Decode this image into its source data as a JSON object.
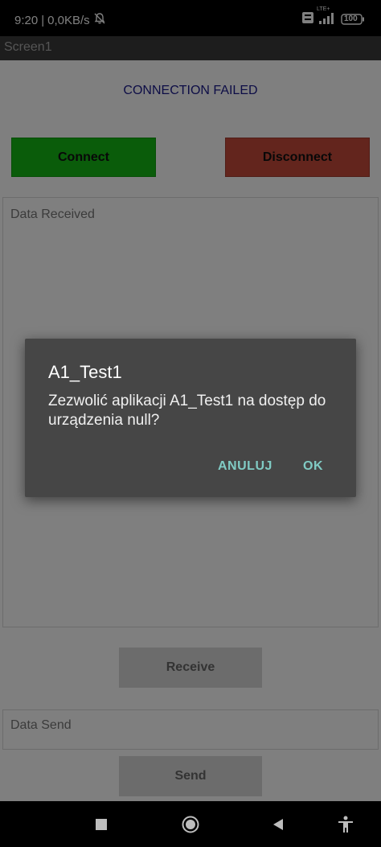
{
  "status_bar": {
    "time": "9:20",
    "separator": "|",
    "speed": "0,0KB/s",
    "network_badge": "LTE+",
    "battery": "100"
  },
  "app_bar": {
    "title": "Screen1"
  },
  "main": {
    "connection_status": "CONNECTION FAILED",
    "connect_label": "Connect",
    "disconnect_label": "Disconnect",
    "data_received_placeholder": "Data Received",
    "receive_label": "Receive",
    "data_send_placeholder": "Data Send",
    "send_label": "Send"
  },
  "dialog": {
    "title": "A1_Test1",
    "message": "Zezwolić aplikacji A1_Test1 na dostęp do urządzenia null?",
    "cancel_label": "ANULUJ",
    "ok_label": "OK"
  },
  "colors": {
    "connect": "#14b814",
    "disconnect": "#c74b3b",
    "dialog_action": "#80cbc4",
    "status_text": "#1a1a8c"
  },
  "icons": [
    "bell-off-icon",
    "volte-icon",
    "signal-icon",
    "battery-icon",
    "square-icon",
    "circle-icon",
    "back-triangle-icon",
    "accessibility-icon"
  ]
}
